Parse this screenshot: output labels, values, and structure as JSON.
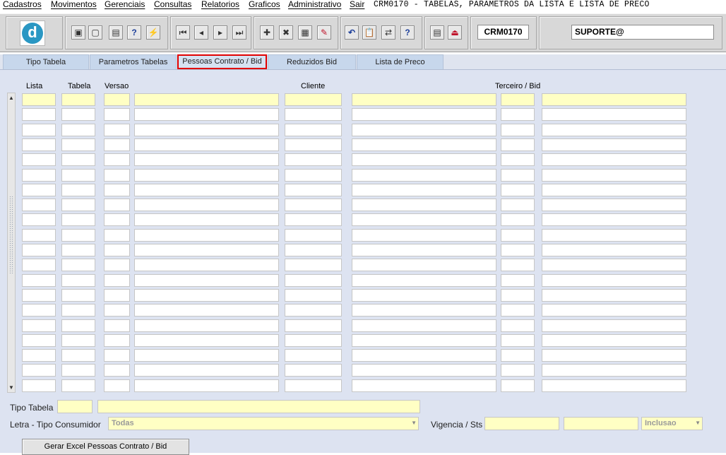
{
  "menu": {
    "items": [
      "Cadastros",
      "Movimentos",
      "Gerenciais",
      "Consultas",
      "Relatorios",
      "Graficos",
      "Administrativo",
      "Sair"
    ],
    "window_title": "CRM0170 - TABELAS, PARAMETROS DA LISTA E LISTA DE PRECO"
  },
  "toolbar": {
    "logo_letter": "d",
    "module_code": "CRM0170",
    "user": "SUPORTE@",
    "glyphs": {
      "save": "▣",
      "window": "▢",
      "print": "▤",
      "query": "?",
      "query_run": "⚡",
      "first": "⏮",
      "prev": "◂",
      "next": "▸",
      "last": "⏭",
      "insert": "✚",
      "delete": "✖",
      "edit": "▦",
      "clear": "✎",
      "undo": "↶",
      "clipboard": "📋",
      "record": "⇄",
      "help": "?",
      "menu": "▤",
      "exit": "⏏"
    }
  },
  "tabs": [
    {
      "label": "Tipo Tabela",
      "active": false
    },
    {
      "label": "Parametros Tabelas",
      "active": false
    },
    {
      "label": "Pessoas Contrato / Bid",
      "active": true
    },
    {
      "label": "Reduzidos Bid",
      "active": false
    },
    {
      "label": "Lista de Preco",
      "active": false
    }
  ],
  "grid": {
    "headers": {
      "lista": "Lista",
      "tabela": "Tabela",
      "versao": "Versao",
      "cliente": "Cliente",
      "terceiro": "Terceiro / Bid"
    },
    "row_count": 20
  },
  "footer": {
    "tipo_tabela_label": "Tipo Tabela",
    "letra_label": "Letra - Tipo Consumidor",
    "letra_value": "Todas",
    "vigencia_label": "Vigencia / Sts",
    "status_value": "Inclusao",
    "excel_button": "Gerar Excel Pessoas Contrato / Bid"
  },
  "colors": {
    "highlight": "#ffffc4",
    "panel": "#dde3f1",
    "active_tab_border": "#e00000"
  }
}
